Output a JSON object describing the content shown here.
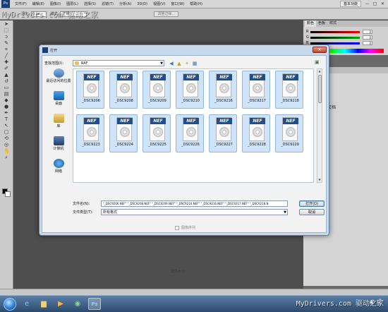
{
  "app": {
    "logo": "Ps",
    "menus": [
      "文件(F)",
      "编辑(E)",
      "图像(I)",
      "图层(L)",
      "选择(S)",
      "滤镜(T)",
      "分析(A)",
      "3D(D)",
      "视图(V)",
      "窗口(W)",
      "帮助(H)"
    ],
    "workspace": "基本功能",
    "window_controls": [
      "—",
      "□",
      "✕"
    ],
    "options": {
      "feather_label": "羽化:",
      "feather_value": "0 px",
      "style_label": "样式:",
      "style_value": "正常",
      "refine_label": "调整边缘..."
    }
  },
  "panels": {
    "color_tabs": [
      "颜色",
      "色板",
      "样式"
    ],
    "sliders": [
      {
        "label": "R",
        "value": "0"
      },
      {
        "label": "G",
        "value": "0"
      },
      {
        "label": "B",
        "value": "0"
      }
    ],
    "history_item": "打开文档"
  },
  "dialog": {
    "title": "打开",
    "lookin_label": "查找范围(I):",
    "lookin_value": "RAF",
    "close_symbol": "✕",
    "places": [
      {
        "label": "最近访问的位置",
        "icon": "recent-places-icon"
      },
      {
        "label": "桌面",
        "icon": "desktop-icon"
      },
      {
        "label": "库",
        "icon": "library-icon"
      },
      {
        "label": "计算机",
        "icon": "computer-icon"
      },
      {
        "label": "网络",
        "icon": "network-icon"
      }
    ],
    "file_badge": "NEF",
    "files": [
      "_DSC9206",
      "_DSC9208",
      "_DSC9209",
      "_DSC9210",
      "_DSC9216",
      "_DSC9217",
      "_DSC9218",
      "_DSC9223",
      "_DSC9224",
      "_DSC9225",
      "_DSC9226",
      "_DSC9227",
      "_DSC9228",
      "_DSC9229"
    ],
    "filename_label": "文件名(N):",
    "filename_value": "\"_DSC9206.NEF\" \"_DSC9208.NEF\" \"_DSC9209.NEF\" \"_DSC9210.NEF\" \"_DSC9216.NEF\" \"_DSC9217.NEF\" \"_DSC9218.N",
    "filetype_label": "文件类型(T):",
    "filetype_value": "所有格式",
    "open_button": "打开(O)",
    "cancel_button": "取消",
    "sequence_label": "图像序列",
    "filesize_label": "文件大小:"
  },
  "watermark": {
    "top": "MyDrivers.com 驱动之家",
    "bottom": "MyDrivers.com 驱动之家"
  },
  "taskbar": {
    "tray_symbols": [
      "▲",
      "🔊"
    ]
  }
}
